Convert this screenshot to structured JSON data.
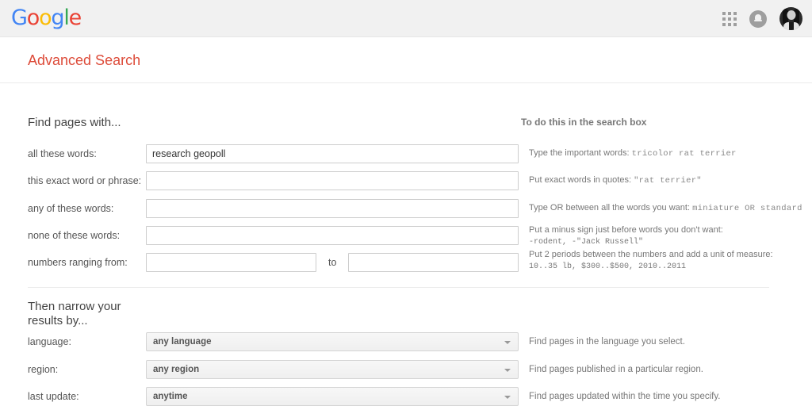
{
  "header": {
    "logo_letters": [
      {
        "ch": "G",
        "color": "#4285f4"
      },
      {
        "ch": "o",
        "color": "#ea4335"
      },
      {
        "ch": "o",
        "color": "#fbbc05"
      },
      {
        "ch": "g",
        "color": "#4285f4"
      },
      {
        "ch": "l",
        "color": "#34a853"
      },
      {
        "ch": "e",
        "color": "#ea4335"
      }
    ],
    "logo_text": "Google",
    "apps_icon": "apps-grid-icon",
    "notifications_icon": "notification-bell-icon",
    "avatar_icon": "user-avatar"
  },
  "page": {
    "title": "Advanced Search",
    "title_color": "#dd4b39"
  },
  "find_section": {
    "heading": "Find pages with...",
    "hints_heading": "To do this in the search box",
    "rows": [
      {
        "label": "all these words:",
        "value": "research geopoll",
        "placeholder": "",
        "hint_prefix": "Type the important words:",
        "hint_mono": "tricolor rat terrier",
        "hint_second_line": ""
      },
      {
        "label": "this exact word or phrase:",
        "value": "",
        "placeholder": "",
        "hint_prefix": "Put exact words in quotes:",
        "hint_mono": "\"rat terrier\"",
        "hint_second_line": ""
      },
      {
        "label": "any of these words:",
        "value": "",
        "placeholder": "",
        "hint_prefix": "Type OR between all the words you want:",
        "hint_mono": "miniature OR standard",
        "hint_second_line": ""
      },
      {
        "label": "none of these words:",
        "value": "",
        "placeholder": "",
        "hint_prefix": "Put a minus sign just before words you don't want:",
        "hint_mono": "",
        "hint_second_line": "-rodent, -\"Jack Russell\""
      },
      {
        "label": "numbers ranging from:",
        "value": "",
        "value_to": "",
        "placeholder": "",
        "separator": "to",
        "hint_prefix": "Put 2 periods between the numbers and add a unit of measure:",
        "hint_mono": "",
        "hint_second_line": "10..35 lb, $300..$500, 2010..2011"
      }
    ]
  },
  "narrow_section": {
    "heading": "Then narrow your results by...",
    "rows": [
      {
        "label": "language:",
        "selected": "any language",
        "hint": "Find pages in the language you select."
      },
      {
        "label": "region:",
        "selected": "any region",
        "hint": "Find pages published in a particular region."
      },
      {
        "label": "last update:",
        "selected": "anytime",
        "hint": "Find pages updated within the time you specify."
      }
    ]
  }
}
